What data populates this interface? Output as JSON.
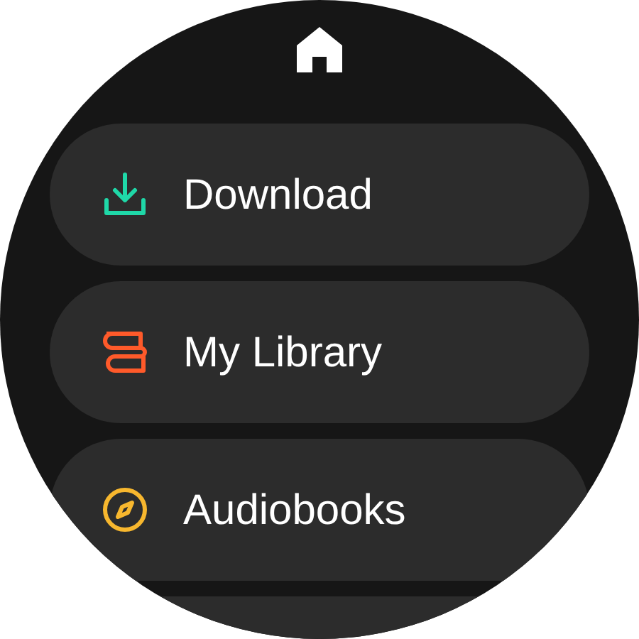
{
  "menu": [
    {
      "kind": "download",
      "label": "Download"
    },
    {
      "kind": "library",
      "label": "My Library"
    },
    {
      "kind": "compass",
      "label": "Audiobooks"
    }
  ]
}
